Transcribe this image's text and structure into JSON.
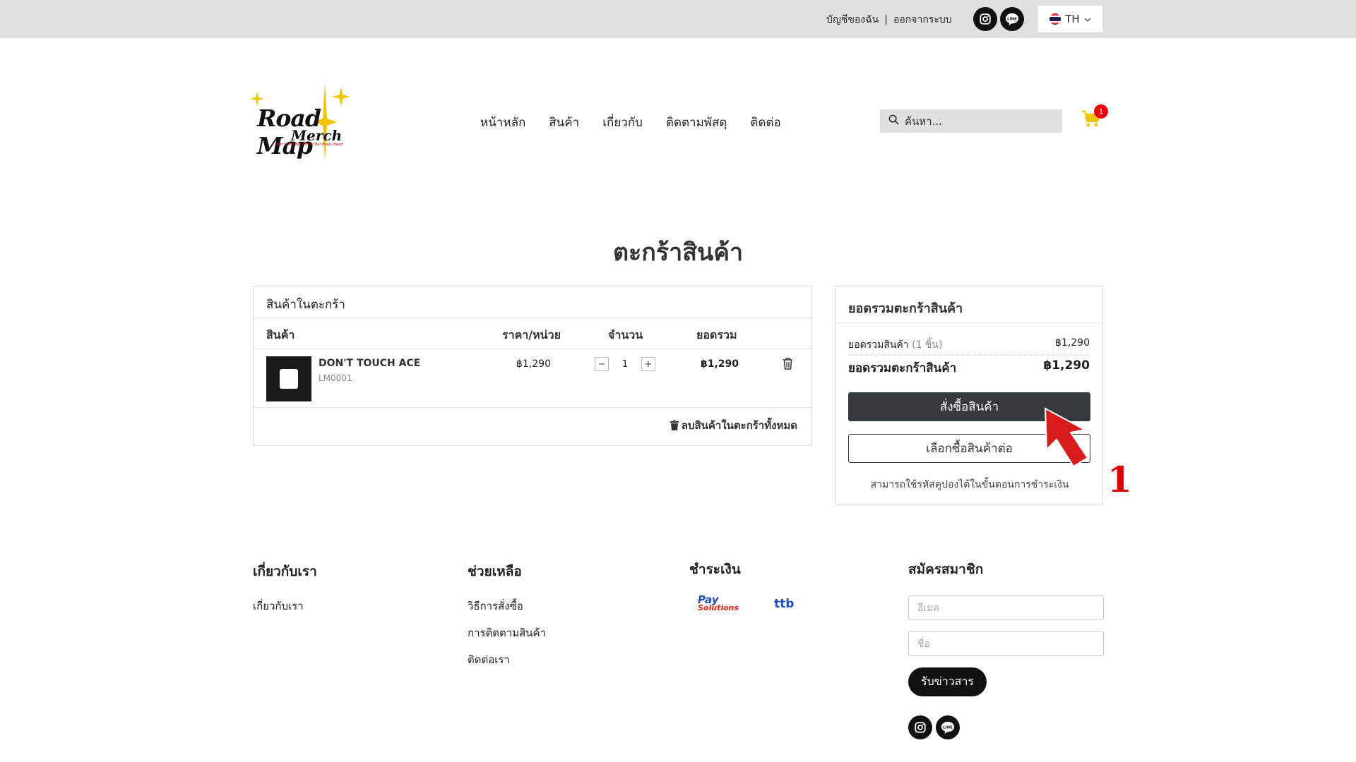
{
  "topbar": {
    "account_label": "บัญชีของฉัน",
    "separator": "|",
    "logout_label": "ออกจากระบบ",
    "language": "TH",
    "social": [
      "instagram-icon",
      "line-icon"
    ]
  },
  "logo": {
    "line1": "Road Map",
    "line2": "Merch",
    "tagline": "Bar sHidd Bau Power Bar Every Heart"
  },
  "nav": {
    "items": [
      "หน้าหลัก",
      "สินค้า",
      "เกี่ยวกับ",
      "ติดตามพัสดุ",
      "ติดต่อ"
    ]
  },
  "search": {
    "placeholder": "ค้นหา..."
  },
  "cart": {
    "badge_count": "1"
  },
  "page_title": "ตะกร้าสินค้า",
  "cart_table": {
    "title": "สินค้าในตะกร้า",
    "columns": {
      "product": "สินค้า",
      "unit_price": "ราคา/หน่วย",
      "quantity": "จำนวน",
      "total": "ยอดรวม"
    },
    "items": [
      {
        "name": "DON'T TOUCH ACE",
        "sku": "LM0001",
        "price": "฿1,290",
        "quantity": "1",
        "total": "฿1,290"
      }
    ],
    "clear_all_label": "ลบสินค้าในตะกร้าทั้งหมด"
  },
  "summary": {
    "title": "ยอดรวมตะกร้าสินค้า",
    "subtotal_label": "ยอดรวมสินค้า",
    "subtotal_count": "(1 ชิ้น)",
    "subtotal_value": "฿1,290",
    "total_label": "ยอดรวมตะกร้าสินค้า",
    "total_value": "฿1,290",
    "order_button": "สั่งซื้อสินค้า",
    "continue_button": "เลือกซื้อสินค้าต่อ",
    "coupon_note": "สามารถใช้รหัสคูปองได้ในขั้นตอนการชำระเงิน"
  },
  "annotation": {
    "number": "1",
    "color": "#dd0000"
  },
  "footer": {
    "about": {
      "title": "เกี่ยวกับเรา",
      "links": [
        "เกี่ยวกับเรา"
      ]
    },
    "help": {
      "title": "ช่วยเหลือ",
      "links": [
        "วิธีการสั่งซื้อ",
        "การติดตามสินค้า",
        "ติดต่อเรา"
      ]
    },
    "payment": {
      "title": "ชำระเงิน",
      "provider1_main": "Pay",
      "provider1_sub": "Solutions",
      "provider2": "ttb"
    },
    "subscribe": {
      "title": "สมัครสมาชิก",
      "email_placeholder": "อีเมล",
      "name_placeholder": "ชื่อ",
      "button": "รับข่าวสาร"
    }
  },
  "colors": {
    "topbar_bg": "#e0e0e0",
    "primary_button": "#333a40",
    "badge": "#ee0000",
    "cart_icon": "#f5c400"
  }
}
